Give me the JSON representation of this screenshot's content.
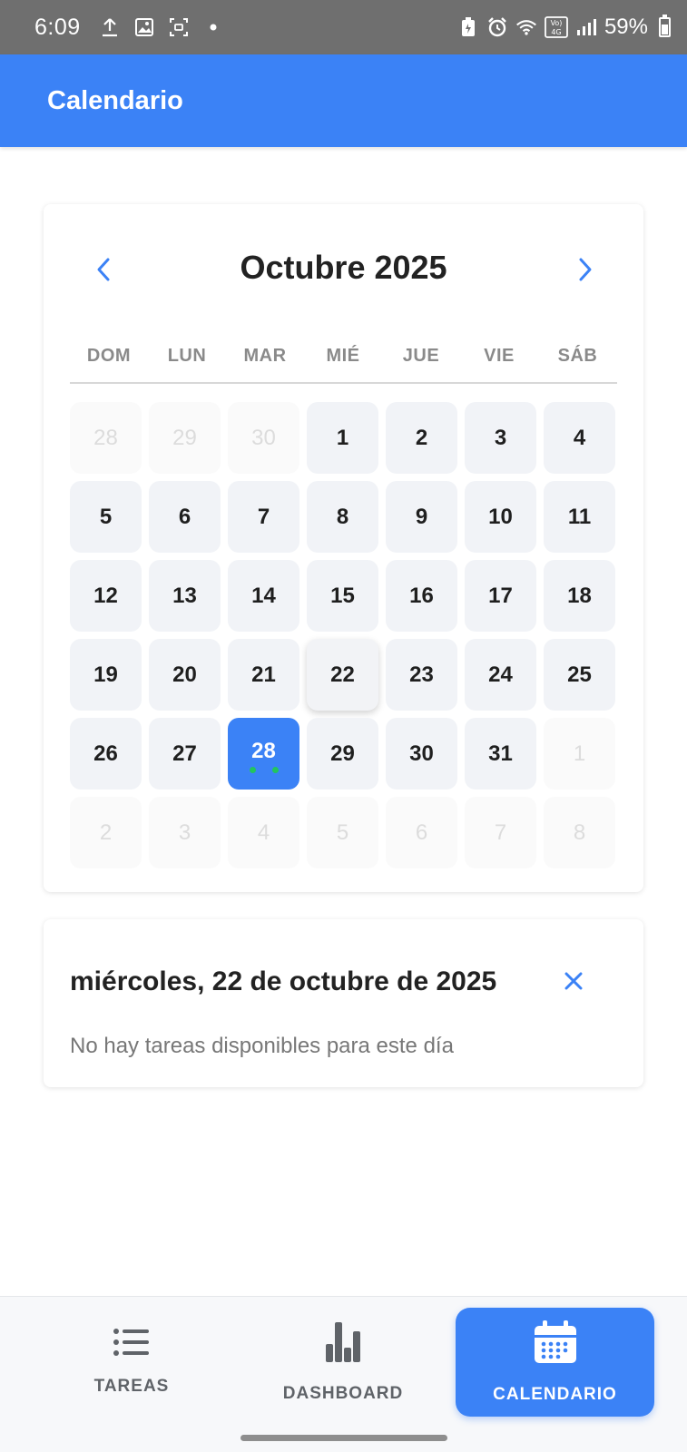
{
  "status_bar": {
    "time": "6:09",
    "battery": "59%",
    "network": "LTE1"
  },
  "app_bar": {
    "title": "Calendario"
  },
  "calendar": {
    "month_title": "Octubre 2025",
    "weekdays": [
      "DOM",
      "LUN",
      "MAR",
      "MIÉ",
      "JUE",
      "VIE",
      "SÁB"
    ],
    "days": [
      {
        "n": "28",
        "other": true
      },
      {
        "n": "29",
        "other": true
      },
      {
        "n": "30",
        "other": true
      },
      {
        "n": "1"
      },
      {
        "n": "2"
      },
      {
        "n": "3"
      },
      {
        "n": "4"
      },
      {
        "n": "5"
      },
      {
        "n": "6"
      },
      {
        "n": "7"
      },
      {
        "n": "8"
      },
      {
        "n": "9"
      },
      {
        "n": "10"
      },
      {
        "n": "11"
      },
      {
        "n": "12"
      },
      {
        "n": "13"
      },
      {
        "n": "14"
      },
      {
        "n": "15"
      },
      {
        "n": "16"
      },
      {
        "n": "17"
      },
      {
        "n": "18"
      },
      {
        "n": "19"
      },
      {
        "n": "20"
      },
      {
        "n": "21"
      },
      {
        "n": "22",
        "hover": true
      },
      {
        "n": "23"
      },
      {
        "n": "24"
      },
      {
        "n": "25"
      },
      {
        "n": "26"
      },
      {
        "n": "27"
      },
      {
        "n": "28",
        "selected": true,
        "dots": 2
      },
      {
        "n": "29"
      },
      {
        "n": "30"
      },
      {
        "n": "31"
      },
      {
        "n": "1",
        "other": true
      },
      {
        "n": "2",
        "other": true
      },
      {
        "n": "3",
        "other": true
      },
      {
        "n": "4",
        "other": true
      },
      {
        "n": "5",
        "other": true
      },
      {
        "n": "6",
        "other": true
      },
      {
        "n": "7",
        "other": true
      },
      {
        "n": "8",
        "other": true
      }
    ]
  },
  "details": {
    "date_label": "miércoles, 22 de octubre de 2025",
    "empty_message": "No hay tareas disponibles para este día"
  },
  "bottom_nav": {
    "tareas": "TAREAS",
    "dashboard": "DASHBOARD",
    "calendario": "CALENDARIO"
  },
  "colors": {
    "primary": "#3b82f6",
    "event_dot": "#22c55e"
  }
}
